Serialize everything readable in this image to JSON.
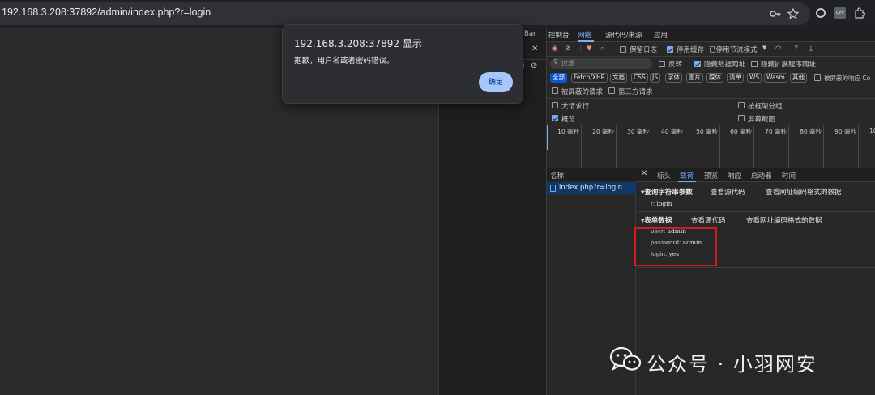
{
  "browser": {
    "url": "192.168.3.208:37892/admin/index.php?r=login",
    "icons": [
      "key-icon",
      "star-icon",
      "extension-record-icon",
      "extension-off-icon",
      "puzzle-icon"
    ],
    "ext_off_label": "OFF"
  },
  "dialog": {
    "title": "192.168.3.208:37892 显示",
    "message": "抱歉，用户名或者密码错误。",
    "ok_label": "确定"
  },
  "devtools": {
    "tabs": [
      "Bar",
      "控制台",
      "网络",
      "源代码/来源",
      "应用"
    ],
    "active_tab": "网络",
    "toolbar": {
      "preserve_log": "保留日志",
      "disable_cache": "停用缓存",
      "throttle": "已停用节流模式"
    },
    "filter": {
      "placeholder": "过滤",
      "invert": "反转",
      "hide_data_urls": "隐藏数据网址",
      "hide_ext_urls": "隐藏扩展程序网址"
    },
    "types": [
      "全部",
      "Fetch/XHR",
      "文档",
      "CSS",
      "JS",
      "字体",
      "图片",
      "媒体",
      "清单",
      "WS",
      "Wasm",
      "其他"
    ],
    "blocked_cookies": "被屏蔽的响应 Co",
    "blocked_requests": "被屏蔽的请求",
    "third_party": "第三方请求",
    "big_rows": "大请求行",
    "group_by_frame": "按框架分组",
    "overview": "概览",
    "screenshots": "屏幕截图",
    "timeline_ticks": [
      "10 毫秒",
      "20 毫秒",
      "30 毫秒",
      "40 毫秒",
      "50 毫秒",
      "60 毫秒",
      "70 毫秒",
      "80 毫秒",
      "90 毫秒",
      "10"
    ],
    "request_list": {
      "header": "名称",
      "rows": [
        "index.php?r=login"
      ]
    },
    "detail": {
      "tabs": [
        "标头",
        "载荷",
        "预览",
        "响应",
        "启动器",
        "时间"
      ],
      "active_tab": "载荷",
      "query": {
        "title": "▾查询字符串参数",
        "view_source": "查看源代码",
        "view_encoded": "查看网址编码格式的数据",
        "params": [
          {
            "key": "r",
            "value": "login"
          }
        ]
      },
      "form": {
        "title": "▾表单数据",
        "view_source": "查看源代码",
        "view_encoded": "查看网址编码格式的数据",
        "params": [
          {
            "key": "user",
            "value": "admin"
          },
          {
            "key": "password",
            "value": "admin"
          },
          {
            "key": "login",
            "value": "yes"
          }
        ]
      }
    }
  },
  "watermark": {
    "text": "公众号 · 小羽网安",
    "icon": "wechat-icon"
  },
  "colors": {
    "accent": "#7cacf8",
    "highlight_box": "#d21d1d",
    "dialog_button": "#a8c7fa"
  }
}
